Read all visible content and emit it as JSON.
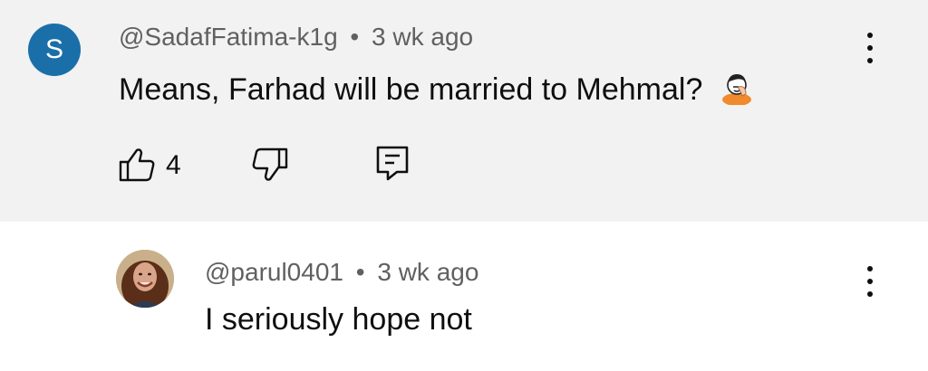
{
  "comment": {
    "avatar_letter": "S",
    "author": "@SadafFatima-k1g",
    "separator": "•",
    "time": "3 wk ago",
    "text": "Means, Farhad will be married to Mehmal?",
    "emoji": "face-palm-emoji",
    "likes": "4",
    "icons": {
      "like": "thumbs-up-icon",
      "dislike": "thumbs-down-icon",
      "reply": "reply-icon",
      "menu": "more-vertical-icon"
    },
    "colors": {
      "background": "#f2f2f2",
      "avatar": "#1b6fa8"
    }
  },
  "reply": {
    "author": "@parul0401",
    "separator": "•",
    "time": "3 wk ago",
    "text": "I seriously hope not",
    "icons": {
      "menu": "more-vertical-icon"
    }
  }
}
